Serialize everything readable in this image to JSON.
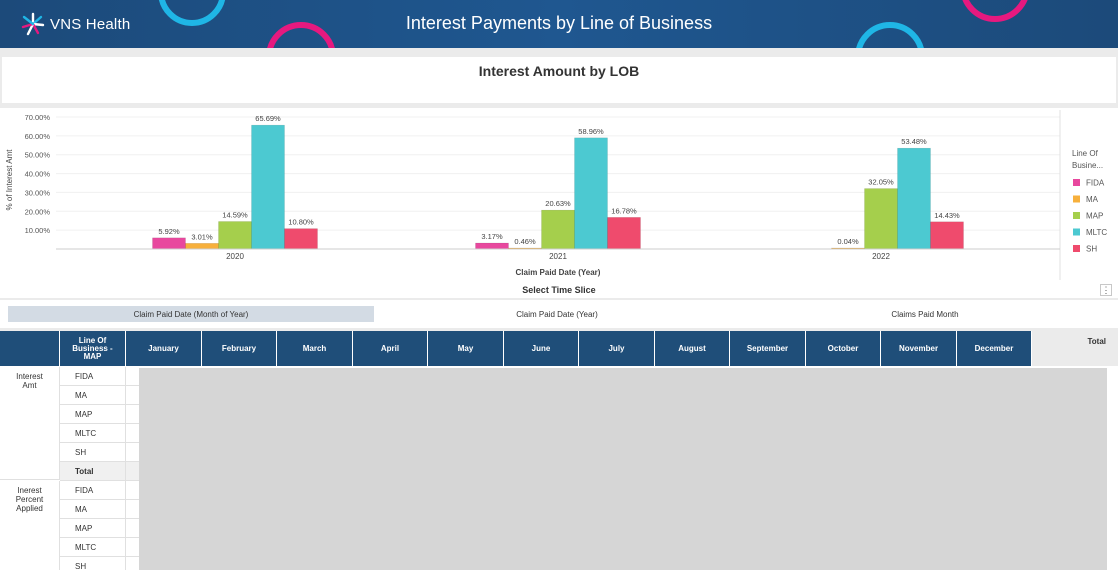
{
  "header": {
    "brand": "VNS Health",
    "title": "Interest Payments by Line of Business"
  },
  "chart_title": "Interest Amount by LOB",
  "chart_data": {
    "type": "bar",
    "title": "Interest Amount by LOB",
    "xlabel": "Claim Paid Date (Year)",
    "ylabel": "% of Interest Amt",
    "ylim": [
      0,
      70
    ],
    "yticks": [
      "70.00%",
      "60.00%",
      "50.00%",
      "40.00%",
      "30.00%",
      "20.00%",
      "10.00%"
    ],
    "categories": [
      "2020",
      "2021",
      "2022"
    ],
    "legend_title": "Line Of Busine...",
    "legend_position": "right",
    "series": [
      {
        "name": "FIDA",
        "color": "#e8489e",
        "values": [
          5.92,
          3.17,
          null
        ],
        "labels": [
          "5.92%",
          "3.17%",
          ""
        ]
      },
      {
        "name": "MA",
        "color": "#f7b03c",
        "values": [
          3.01,
          0.46,
          0.04
        ],
        "labels": [
          "3.01%",
          "0.46%",
          "0.04%"
        ]
      },
      {
        "name": "MAP",
        "color": "#a5cf4c",
        "values": [
          14.59,
          20.63,
          32.05
        ],
        "labels": [
          "14.59%",
          "20.63%",
          "32.05%"
        ]
      },
      {
        "name": "MLTC",
        "color": "#4cc9d1",
        "values": [
          65.69,
          58.96,
          53.48
        ],
        "labels": [
          "65.69%",
          "58.96%",
          "53.48%"
        ]
      },
      {
        "name": "SH",
        "color": "#ef4b6d",
        "values": [
          10.8,
          16.78,
          14.43
        ],
        "labels": [
          "10.80%",
          "16.78%",
          "14.43%"
        ]
      }
    ]
  },
  "time_slice": {
    "title": "Select Time Slice",
    "options": [
      "Claim Paid Date (Month of Year)",
      "Claim Paid Date (Year)",
      "Claims Paid Month"
    ],
    "active_index": 0,
    "more_icon": "⋮"
  },
  "table": {
    "lob_header": "Line Of Business - MAP",
    "months": [
      "January",
      "February",
      "March",
      "April",
      "May",
      "June",
      "July",
      "August",
      "September",
      "October",
      "November",
      "December"
    ],
    "total_header": "Total",
    "groups": [
      {
        "label": "Interest Amt",
        "rows": [
          "FIDA",
          "MA",
          "MAP",
          "MLTC",
          "SH",
          "Total"
        ]
      },
      {
        "label": "Inerest Percent Applied",
        "rows": [
          "FIDA",
          "MA",
          "MAP",
          "MLTC",
          "SH"
        ]
      }
    ]
  },
  "colors": {
    "header_bg": "#1f5790",
    "table_header": "#1f4e79",
    "ring_cyan": "#1fb6e6",
    "ring_pink": "#e6197f"
  }
}
